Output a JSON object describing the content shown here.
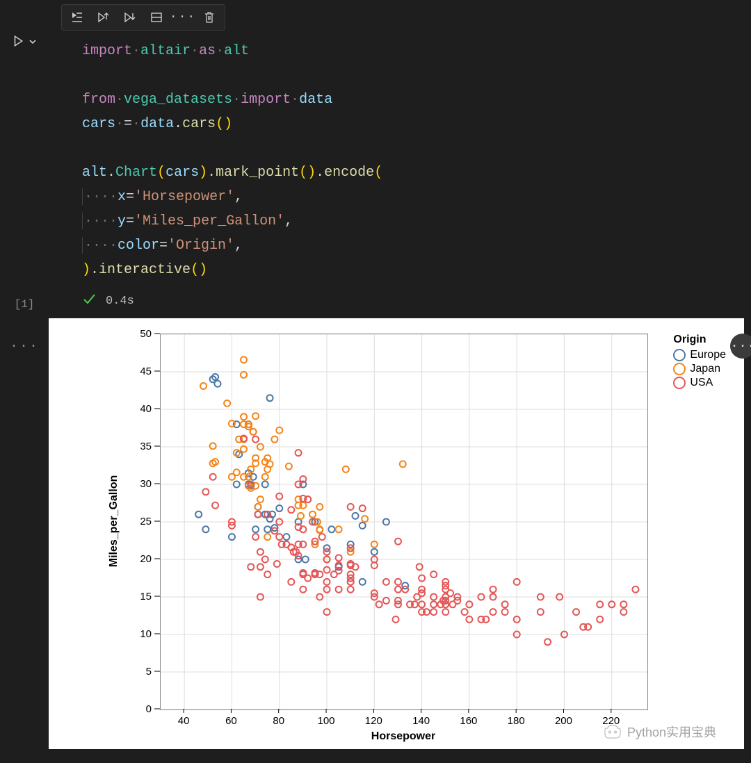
{
  "toolbar": {
    "run_by_line": "Run by Line",
    "execute_above": "Execute Above",
    "execute_below": "Execute Below",
    "split_cell": "Split Cell",
    "more": "···",
    "delete": "Delete Cell"
  },
  "gutter": {
    "exec_count": "[1]",
    "more": "···"
  },
  "code": {
    "l1": {
      "import": "import",
      "sp": "·",
      "altair": "altair",
      "as": "as",
      "alt": "alt"
    },
    "l3": {
      "from": "from",
      "sp": "·",
      "pkg": "vega_datasets",
      "import": "import",
      "data": "data"
    },
    "l4": {
      "cars": "cars",
      "eq": "=",
      "data": "data",
      "dot": ".",
      "carsfn": "cars",
      "par": "()"
    },
    "l6": {
      "alt": "alt",
      "Chart": "Chart",
      "cars": "cars",
      "mark": "mark_point",
      "encode": "encode"
    },
    "l7": {
      "dots": "····",
      "x": "x",
      "val": "'Horsepower'"
    },
    "l8": {
      "dots": "····",
      "y": "y",
      "val": "'Miles_per_Gallon'"
    },
    "l9": {
      "dots": "····",
      "color": "color",
      "val": "'Origin'"
    },
    "l10": {
      "interactive": "interactive"
    }
  },
  "status": {
    "time": "0.4s"
  },
  "watermark": "Python实用宝典",
  "chart_data": {
    "type": "scatter",
    "xlabel": "Horsepower",
    "ylabel": "Miles_per_Gallon",
    "xlim": [
      30,
      235
    ],
    "ylim": [
      0,
      50
    ],
    "xticks": [
      40,
      60,
      80,
      100,
      120,
      140,
      160,
      180,
      200,
      220
    ],
    "yticks": [
      0,
      5,
      10,
      15,
      20,
      25,
      30,
      35,
      40,
      45,
      50
    ],
    "legend_title": "Origin",
    "colors": {
      "Europe": "#4c78a8",
      "Japan": "#f58518",
      "USA": "#e45756"
    },
    "series": [
      {
        "name": "Europe",
        "points": [
          [
            46,
            26
          ],
          [
            49,
            24
          ],
          [
            52,
            44
          ],
          [
            53,
            44.3
          ],
          [
            54,
            43.4
          ],
          [
            60,
            23
          ],
          [
            62,
            38
          ],
          [
            62,
            30
          ],
          [
            63,
            34
          ],
          [
            65,
            36.1
          ],
          [
            67,
            31.5
          ],
          [
            67,
            30
          ],
          [
            67,
            38
          ],
          [
            68,
            29.8
          ],
          [
            69,
            31
          ],
          [
            69,
            37
          ],
          [
            70,
            24
          ],
          [
            71,
            26
          ],
          [
            71,
            27
          ],
          [
            74,
            26
          ],
          [
            74,
            30
          ],
          [
            75,
            24
          ],
          [
            76,
            25.4
          ],
          [
            76,
            41.5
          ],
          [
            77,
            26
          ],
          [
            78,
            24.2
          ],
          [
            80,
            26.8
          ],
          [
            83,
            23
          ],
          [
            88,
            20
          ],
          [
            88,
            25
          ],
          [
            90,
            30
          ],
          [
            91,
            20
          ],
          [
            95,
            25
          ],
          [
            100,
            21.5
          ],
          [
            102,
            24
          ],
          [
            105,
            19
          ],
          [
            110,
            22
          ],
          [
            110,
            17
          ],
          [
            112,
            25.8
          ],
          [
            115,
            24.5
          ],
          [
            115,
            17
          ],
          [
            120,
            21
          ],
          [
            125,
            25
          ],
          [
            133,
            16.5
          ]
        ]
      },
      {
        "name": "Japan",
        "points": [
          [
            48,
            43.1
          ],
          [
            52,
            35.1
          ],
          [
            52,
            32.8
          ],
          [
            53,
            33
          ],
          [
            58,
            40.8
          ],
          [
            60,
            31
          ],
          [
            60,
            38.1
          ],
          [
            62,
            31.6
          ],
          [
            62,
            34.2
          ],
          [
            63,
            36
          ],
          [
            65,
            46.6
          ],
          [
            65,
            39
          ],
          [
            65,
            44.6
          ],
          [
            65,
            34.7
          ],
          [
            65,
            38
          ],
          [
            65,
            31
          ],
          [
            65,
            36
          ],
          [
            67,
            29.8
          ],
          [
            67,
            31
          ],
          [
            67,
            38
          ],
          [
            67,
            37.7
          ],
          [
            68,
            29.5
          ],
          [
            68,
            32
          ],
          [
            69,
            37
          ],
          [
            70,
            32.8
          ],
          [
            70,
            29.8
          ],
          [
            70,
            33.5
          ],
          [
            70,
            39.1
          ],
          [
            71,
            27
          ],
          [
            72,
            35
          ],
          [
            72,
            28
          ],
          [
            74,
            33
          ],
          [
            74,
            31
          ],
          [
            75,
            23
          ],
          [
            75,
            32
          ],
          [
            75,
            33.5
          ],
          [
            76,
            32.7
          ],
          [
            78,
            36
          ],
          [
            80,
            37.2
          ],
          [
            84,
            32.4
          ],
          [
            88,
            27.2
          ],
          [
            88,
            28
          ],
          [
            89,
            25.8
          ],
          [
            90,
            27.2
          ],
          [
            92,
            28
          ],
          [
            94,
            26
          ],
          [
            95,
            22
          ],
          [
            96,
            25
          ],
          [
            97,
            27
          ],
          [
            97,
            23.9
          ],
          [
            97,
            24
          ],
          [
            100,
            20
          ],
          [
            105,
            24
          ],
          [
            108,
            32
          ],
          [
            110,
            21
          ],
          [
            116,
            25.4
          ],
          [
            120,
            22
          ],
          [
            132,
            32.7
          ]
        ]
      },
      {
        "name": "USA",
        "points": [
          [
            49,
            29
          ],
          [
            52,
            31
          ],
          [
            53,
            27.2
          ],
          [
            60,
            24.5
          ],
          [
            60,
            25
          ],
          [
            65,
            36.1
          ],
          [
            68,
            30
          ],
          [
            68,
            19
          ],
          [
            70,
            23
          ],
          [
            70,
            36
          ],
          [
            71,
            26
          ],
          [
            72,
            21
          ],
          [
            72,
            19
          ],
          [
            72,
            15
          ],
          [
            74,
            20
          ],
          [
            75,
            18
          ],
          [
            75,
            26
          ],
          [
            78,
            23.8
          ],
          [
            79,
            19.4
          ],
          [
            80,
            23
          ],
          [
            80,
            28.4
          ],
          [
            80,
            25
          ],
          [
            81,
            22
          ],
          [
            83,
            22
          ],
          [
            85,
            17
          ],
          [
            85,
            21.6
          ],
          [
            85,
            26.6
          ],
          [
            86,
            21
          ],
          [
            87,
            21
          ],
          [
            88,
            22
          ],
          [
            88,
            30
          ],
          [
            88,
            24.3
          ],
          [
            88,
            20.5
          ],
          [
            88,
            34.2
          ],
          [
            90,
            28.1
          ],
          [
            90,
            22
          ],
          [
            90,
            18.2
          ],
          [
            90,
            16
          ],
          [
            90,
            18
          ],
          [
            90,
            24
          ],
          [
            90,
            30.7
          ],
          [
            92,
            17.5
          ],
          [
            92,
            28
          ],
          [
            94,
            25
          ],
          [
            95,
            18
          ],
          [
            95,
            22.4
          ],
          [
            95,
            18.2
          ],
          [
            97,
            18
          ],
          [
            97,
            15
          ],
          [
            98,
            23
          ],
          [
            100,
            17
          ],
          [
            100,
            16
          ],
          [
            100,
            18.6
          ],
          [
            100,
            21
          ],
          [
            100,
            13
          ],
          [
            100,
            20
          ],
          [
            103,
            18
          ],
          [
            105,
            19.2
          ],
          [
            105,
            16
          ],
          [
            105,
            18.5
          ],
          [
            105,
            20.2
          ],
          [
            110,
            17.5
          ],
          [
            110,
            27
          ],
          [
            110,
            17
          ],
          [
            110,
            16
          ],
          [
            110,
            21.5
          ],
          [
            110,
            19.2
          ],
          [
            110,
            18
          ],
          [
            110,
            19.4
          ],
          [
            112,
            19
          ],
          [
            115,
            26.8
          ],
          [
            120,
            19.2
          ],
          [
            120,
            20
          ],
          [
            120,
            15
          ],
          [
            120,
            15.5
          ],
          [
            122,
            14
          ],
          [
            125,
            17
          ],
          [
            125,
            14.5
          ],
          [
            129,
            12
          ],
          [
            130,
            17
          ],
          [
            130,
            14
          ],
          [
            130,
            14.5
          ],
          [
            130,
            16
          ],
          [
            130,
            22.4
          ],
          [
            133,
            16
          ],
          [
            135,
            14
          ],
          [
            137,
            14
          ],
          [
            138,
            15
          ],
          [
            139,
            19
          ],
          [
            140,
            16
          ],
          [
            140,
            15.5
          ],
          [
            140,
            13
          ],
          [
            140,
            17.5
          ],
          [
            140,
            14
          ],
          [
            142,
            13
          ],
          [
            145,
            15
          ],
          [
            145,
            14
          ],
          [
            145,
            18
          ],
          [
            145,
            13
          ],
          [
            148,
            14
          ],
          [
            149,
            14.5
          ],
          [
            150,
            15
          ],
          [
            150,
            14
          ],
          [
            150,
            16
          ],
          [
            150,
            13
          ],
          [
            150,
            14.5
          ],
          [
            150,
            17
          ],
          [
            150,
            16.5
          ],
          [
            152,
            15.5
          ],
          [
            153,
            14
          ],
          [
            155,
            14.5
          ],
          [
            155,
            15
          ],
          [
            158,
            13
          ],
          [
            160,
            12
          ],
          [
            160,
            14
          ],
          [
            165,
            15
          ],
          [
            165,
            12
          ],
          [
            167,
            12
          ],
          [
            170,
            13
          ],
          [
            170,
            15
          ],
          [
            170,
            16
          ],
          [
            175,
            13
          ],
          [
            175,
            14
          ],
          [
            180,
            12
          ],
          [
            180,
            10
          ],
          [
            180,
            17
          ],
          [
            190,
            15
          ],
          [
            190,
            13
          ],
          [
            193,
            9
          ],
          [
            198,
            15
          ],
          [
            200,
            10
          ],
          [
            205,
            13
          ],
          [
            208,
            11
          ],
          [
            210,
            11
          ],
          [
            215,
            14
          ],
          [
            215,
            12
          ],
          [
            220,
            14
          ],
          [
            225,
            13
          ],
          [
            225,
            14
          ],
          [
            230,
            16
          ]
        ]
      }
    ]
  }
}
